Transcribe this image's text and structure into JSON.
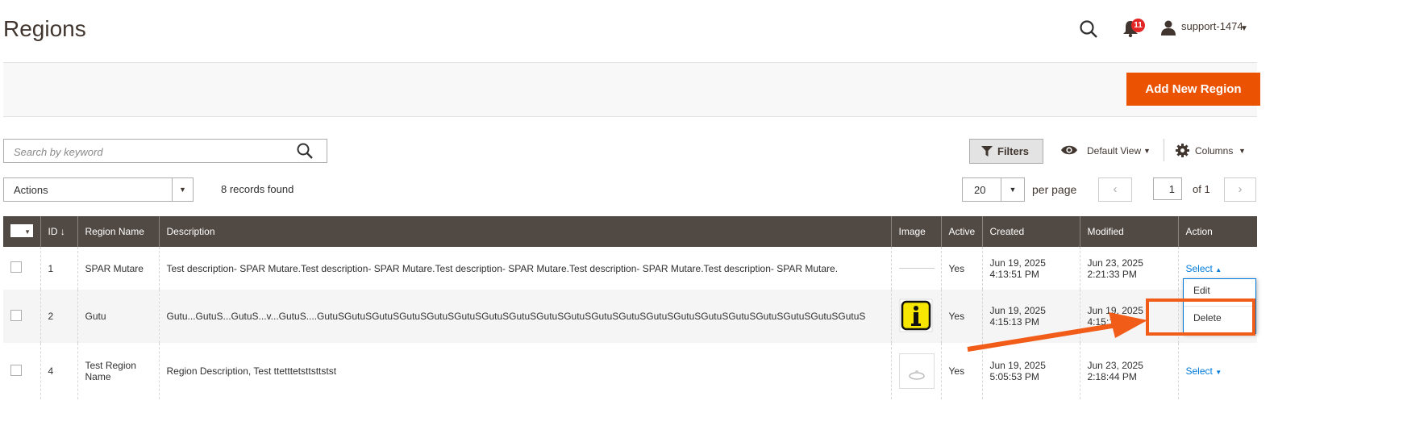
{
  "page": {
    "title": "Regions"
  },
  "header": {
    "notification_count": "11",
    "user_name": "support-1474"
  },
  "toolbar": {
    "add_button_label": "Add New Region"
  },
  "search": {
    "placeholder": "Search by keyword"
  },
  "controls": {
    "filters_label": "Filters",
    "view_label": "Default View",
    "columns_label": "Columns",
    "actions_label": "Actions",
    "records_found": "8 records found",
    "per_page_value": "20",
    "per_page_label": "per page",
    "page_number": "1",
    "page_of": "of 1"
  },
  "grid": {
    "columns": [
      "ID",
      "Region Name",
      "Description",
      "Image",
      "Active",
      "Created",
      "Modified",
      "Action"
    ],
    "rows": [
      {
        "id": "1",
        "name": "SPAR Mutare",
        "description": "Test description- SPAR Mutare.Test description- SPAR Mutare.Test description- SPAR Mutare.Test description- SPAR Mutare.Test description- SPAR Mutare.",
        "active": "Yes",
        "created": "Jun 19, 2025 4:13:51 PM",
        "modified": "Jun 23, 2025 2:21:33 PM",
        "action": "Select"
      },
      {
        "id": "2",
        "name": "Gutu",
        "description": "Gutu...GutuS...GutuS...v...GutuS....GutuSGutuSGutuSGutuSGutuSGutuSGutuSGutuSGutuSGutuSGutuSGutuSGutuSGutuSGutuSGutuSGutuSGutuSGutuSGutuS",
        "active": "Yes",
        "created": "Jun 19, 2025 4:15:13 PM",
        "modified": "Jun 19, 2025 4:15:13 PM",
        "action": ""
      },
      {
        "id": "4",
        "name": "Test Region Name",
        "description": "Region Description, Test ttetttetsttsttstst",
        "active": "Yes",
        "created": "Jun 19, 2025 5:05:53 PM",
        "modified": "Jun 23, 2025 2:18:44 PM",
        "action": "Select"
      }
    ]
  },
  "dropdown": {
    "edit": "Edit",
    "delete": "Delete"
  },
  "colors": {
    "accent": "#eb5202",
    "header_bg": "#514943",
    "link": "#007bdb",
    "annotation": "#f25c19"
  }
}
